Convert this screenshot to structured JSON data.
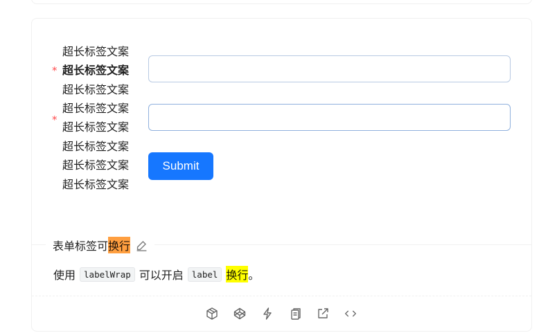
{
  "form": {
    "label_lines": [
      "超长标签文案",
      "超长标签文案",
      "超长标签文案",
      "超长标签文案",
      "超长标签文案",
      "超长标签文案",
      "超长标签文案",
      "超长标签文案"
    ],
    "required_mark": "*",
    "submit_label": "Submit",
    "input_border_color": "#b7c9e2"
  },
  "demo": {
    "title_before": "表单标签可",
    "title_highlight": "换行",
    "desc_prefix": "使用",
    "code_1": "labelWrap",
    "desc_middle": "可以开启",
    "code_2": "label",
    "desc_highlight": "换行",
    "desc_suffix": "。"
  },
  "icons": [
    "edit-icon",
    "codesandbox-icon",
    "codepen-icon",
    "stackblitz-icon",
    "copy-icon",
    "external-link-icon",
    "code-icon"
  ],
  "colors": {
    "primary": "#1677ff",
    "required": "#ff4d4f",
    "highlight_orange": "#ff9f40",
    "highlight_yellow": "#ffff00"
  }
}
